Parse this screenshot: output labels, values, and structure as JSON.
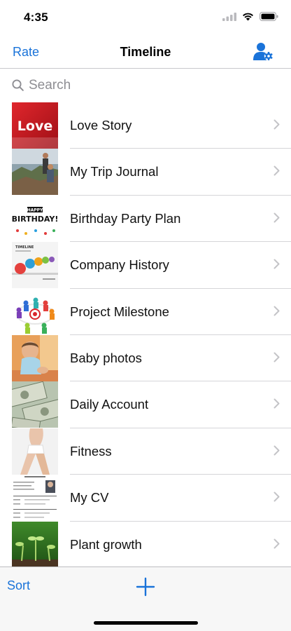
{
  "status": {
    "time": "4:35"
  },
  "nav": {
    "left_label": "Rate",
    "title": "Timeline"
  },
  "search": {
    "placeholder": "Search"
  },
  "items": [
    {
      "label": "Love Story",
      "thumb_text": "Love"
    },
    {
      "label": "My Trip Journal"
    },
    {
      "label": "Birthday Party Plan",
      "thumb_text": "BIRTHDAY!",
      "thumb_subtext": "HAPPY"
    },
    {
      "label": "Company History",
      "thumb_text": "TIMELINE"
    },
    {
      "label": "Project Milestone"
    },
    {
      "label": "Baby photos"
    },
    {
      "label": "Daily Account"
    },
    {
      "label": "Fitness"
    },
    {
      "label": "My CV"
    },
    {
      "label": "Plant growth"
    }
  ],
  "toolbar": {
    "sort_label": "Sort"
  },
  "colors": {
    "accent": "#1a73d9",
    "separator": "#d5d5d8",
    "secondary_text": "#8e8e93"
  },
  "icons": {
    "nav_right": "user-settings-icon",
    "search": "search-icon",
    "row_disclosure": "chevron-right-icon",
    "toolbar_add": "plus-icon"
  }
}
